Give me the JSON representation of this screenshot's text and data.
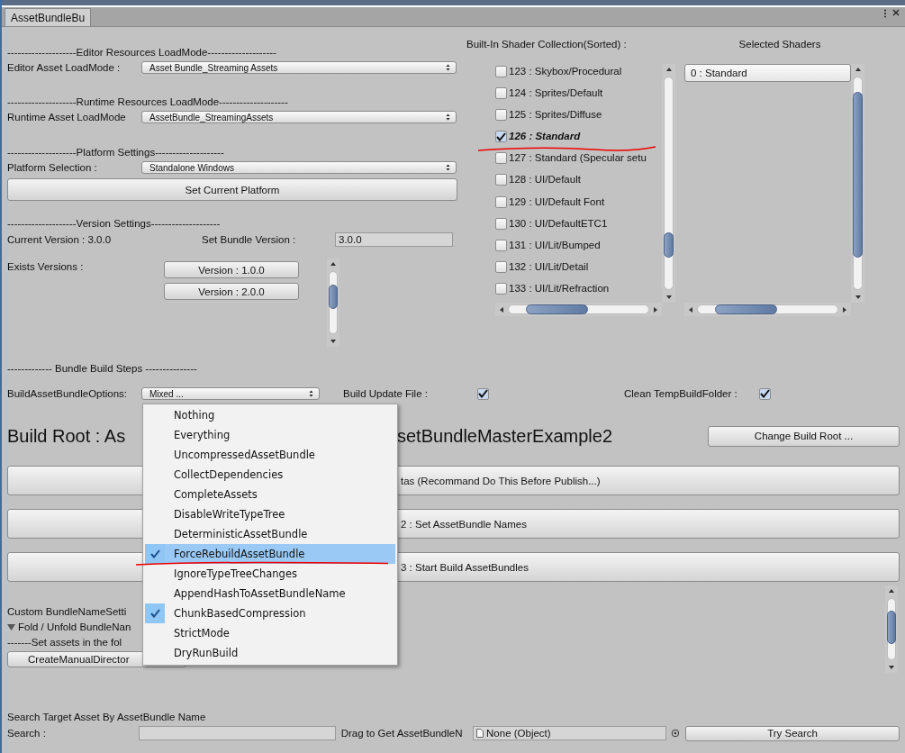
{
  "tab": {
    "label": "AssetBundleBu",
    "selected": true
  },
  "editor_load": {
    "header": "--------------------Editor Resources LoadMode--------------------",
    "label": "Editor Asset LoadMode :",
    "value": "Asset Bundle_Streaming Assets"
  },
  "runtime_load": {
    "header": "--------------------Runtime Resources LoadMode--------------------",
    "label": "Runtime Asset LoadMode",
    "value": "AssetBundle_StreamingAssets"
  },
  "platform": {
    "header": "--------------------Platform Settings--------------------",
    "label": "Platform Selection :",
    "value": "Standalone Windows",
    "button": "Set Current Platform"
  },
  "version": {
    "header": "--------------------Version Settings--------------------",
    "current": "Current Version : 3.0.0",
    "set_label": "Set Bundle Version :",
    "set_value": "3.0.0",
    "exists_label": "Exists Versions :",
    "versions": [
      "Version : 1.0.0",
      "Version : 2.0.0"
    ]
  },
  "shaders": {
    "title": "Built-In Shader Collection(Sorted) :",
    "selected_title": "Selected Shaders",
    "items": [
      {
        "label": "123 : Skybox/Procedural",
        "checked": false
      },
      {
        "label": "124 : Sprites/Default",
        "checked": false
      },
      {
        "label": "125 : Sprites/Diffuse",
        "checked": false
      },
      {
        "label": "126 : Standard",
        "checked": true
      },
      {
        "label": "127 : Standard (Specular setu",
        "checked": false
      },
      {
        "label": "128 : UI/Default",
        "checked": false
      },
      {
        "label": "129 : UI/Default Font",
        "checked": false
      },
      {
        "label": "130 : UI/DefaultETC1",
        "checked": false
      },
      {
        "label": "131 : UI/Lit/Bumped",
        "checked": false
      },
      {
        "label": "132 : UI/Lit/Detail",
        "checked": false
      },
      {
        "label": "133 : UI/Lit/Refraction",
        "checked": false
      }
    ],
    "selected_items": [
      "0 : Standard"
    ]
  },
  "build_steps": {
    "header": "------------- Bundle Build Steps ---------------",
    "options_label": "BuildAssetBundleOptions:",
    "options_value": "Mixed ...",
    "update_label": "Build Update File :",
    "update_checked": true,
    "clean_label": "Clean TempBuildFolder :",
    "clean_checked": true
  },
  "build_root": {
    "title_start": "Build Root : As",
    "title_end": "setBundleMasterExample2",
    "button": "Change Build Root ..."
  },
  "step_buttons": [
    "tas (Recommand Do This Before Publish...)",
    "2 : Set AssetBundle Names",
    "3 : Start Build AssetBundles"
  ],
  "custom": {
    "title": "Custom BundleNameSetti",
    "fold": "Fold / Unfold BundleNan",
    "expanded": true,
    "note": "-------Set assets in the fol",
    "button": "CreateManualDirector"
  },
  "search": {
    "title": "Search Target Asset By AssetBundle Name",
    "label": "Search :",
    "drag_label": "Drag to Get AssetBundleN",
    "object_value": "None (Object)",
    "button": "Try Search"
  },
  "menu": {
    "items": [
      {
        "label": "Nothing",
        "checked": false,
        "highlighted": false
      },
      {
        "label": "Everything",
        "checked": false,
        "highlighted": false
      },
      {
        "label": "UncompressedAssetBundle",
        "checked": false,
        "highlighted": false
      },
      {
        "label": "CollectDependencies",
        "checked": false,
        "highlighted": false
      },
      {
        "label": "CompleteAssets",
        "checked": false,
        "highlighted": false
      },
      {
        "label": "DisableWriteTypeTree",
        "checked": false,
        "highlighted": false
      },
      {
        "label": "DeterministicAssetBundle",
        "checked": false,
        "highlighted": false
      },
      {
        "label": "ForceRebuildAssetBundle",
        "checked": true,
        "highlighted": true
      },
      {
        "label": "IgnoreTypeTreeChanges",
        "checked": false,
        "highlighted": false
      },
      {
        "label": "AppendHashToAssetBundleName",
        "checked": false,
        "highlighted": false
      },
      {
        "label": "ChunkBasedCompression",
        "checked": true,
        "highlighted": false
      },
      {
        "label": "StrictMode",
        "checked": false,
        "highlighted": false
      },
      {
        "label": "DryRunBuild",
        "checked": false,
        "highlighted": false
      }
    ]
  }
}
